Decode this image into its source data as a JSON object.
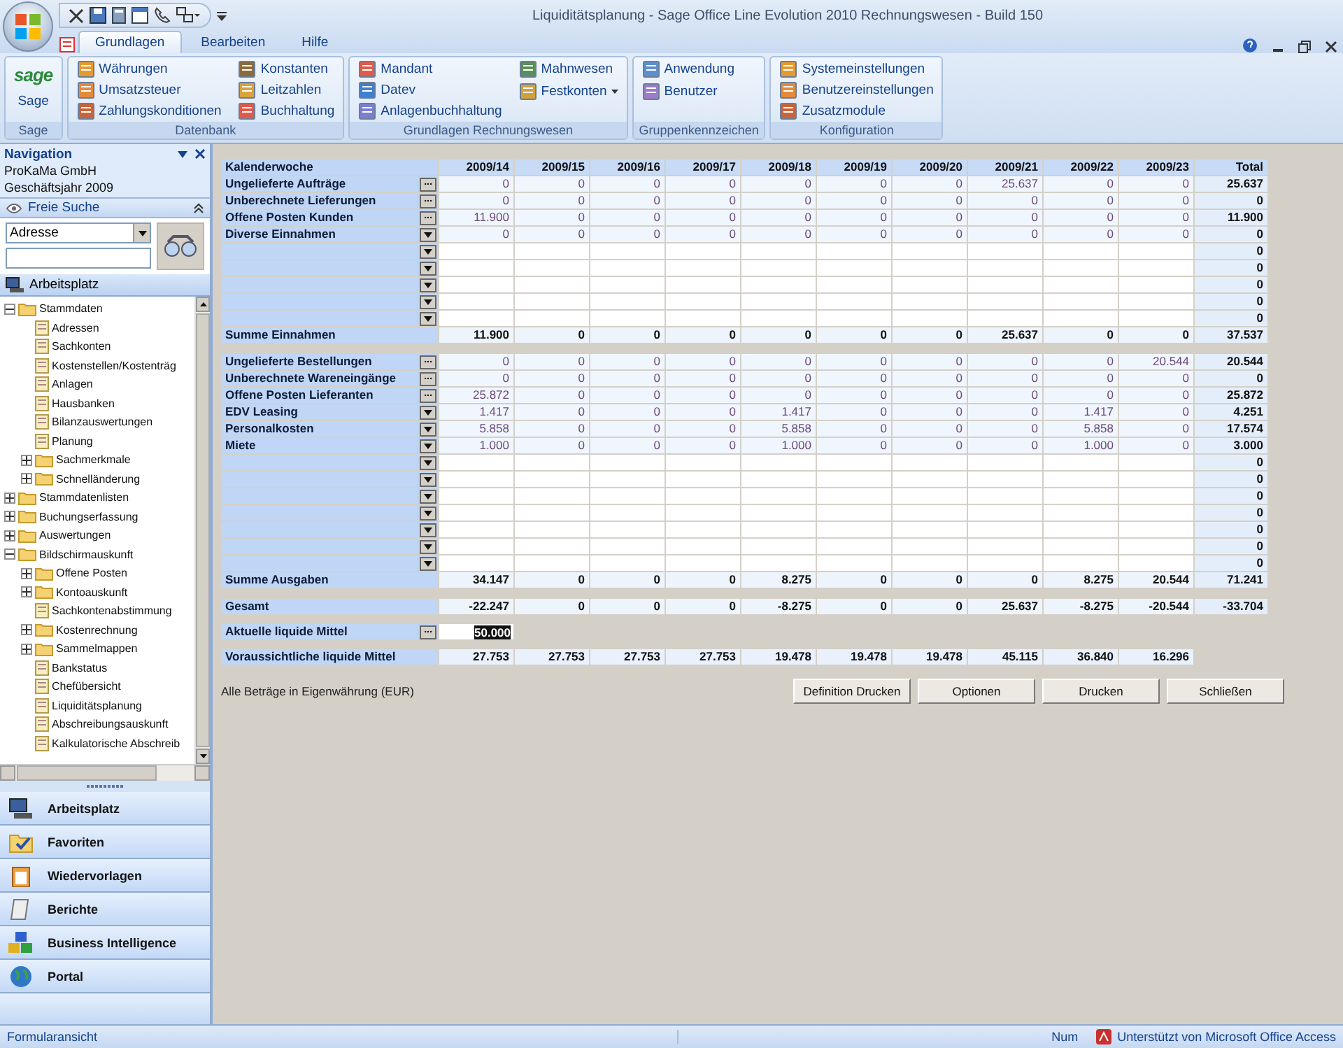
{
  "window": {
    "title": "Liquiditätsplanung - Sage Office Line Evolution 2010 Rechnungswesen - Build 150"
  },
  "ribbon": {
    "tabs": [
      {
        "label": "Grundlagen",
        "selected": true
      },
      {
        "label": "Bearbeiten",
        "selected": false
      },
      {
        "label": "Hilfe",
        "selected": false
      }
    ],
    "groups": [
      {
        "kind": "logo",
        "logo": "sage",
        "caption": "Sage",
        "label": "Sage"
      },
      {
        "kind": "items",
        "label": "Datenbank",
        "columns": [
          [
            {
              "label": "Währungen",
              "dropdown": false
            },
            {
              "label": "Umsatzsteuer",
              "dropdown": false
            },
            {
              "label": "Zahlungskonditionen",
              "dropdown": false
            }
          ],
          [
            {
              "label": "Konstanten",
              "dropdown": false
            },
            {
              "label": "Leitzahlen",
              "dropdown": false
            },
            {
              "label": "Buchhaltung",
              "dropdown": false
            }
          ]
        ]
      },
      {
        "kind": "items",
        "label": "Grundlagen Rechnungswesen",
        "columns": [
          [
            {
              "label": "Mandant",
              "dropdown": false
            },
            {
              "label": "Datev",
              "dropdown": false
            },
            {
              "label": "Anlagenbuchhaltung",
              "dropdown": false
            }
          ],
          [
            {
              "label": "Mahnwesen",
              "dropdown": false
            },
            {
              "label": "Festkonten",
              "dropdown": true
            }
          ]
        ]
      },
      {
        "kind": "items",
        "label": "Gruppenkennzeichen",
        "columns": [
          [
            {
              "label": "Anwendung",
              "dropdown": false
            },
            {
              "label": "Benutzer",
              "dropdown": false
            }
          ]
        ]
      },
      {
        "kind": "items",
        "label": "Konfiguration",
        "columns": [
          [
            {
              "label": "Systemeinstellungen",
              "dropdown": false
            },
            {
              "label": "Benutzereinstellungen",
              "dropdown": false
            },
            {
              "label": "Zusatzmodule",
              "dropdown": false
            }
          ]
        ]
      }
    ]
  },
  "nav": {
    "title": "Navigation",
    "company": "ProKaMa GmbH",
    "fiscal_year": "Geschäftsjahr 2009",
    "search_title": "Freie Suche",
    "search_select": "Adresse",
    "section": "Arbeitsplatz",
    "tree": [
      {
        "kind": "folder",
        "label": "Stammdaten",
        "expanded": true,
        "children": [
          {
            "kind": "doc",
            "label": "Adressen"
          },
          {
            "kind": "doc",
            "label": "Sachkonten"
          },
          {
            "kind": "doc",
            "label": "Kostenstellen/Kostenträg"
          },
          {
            "kind": "doc",
            "label": "Anlagen"
          },
          {
            "kind": "doc",
            "label": "Hausbanken"
          },
          {
            "kind": "doc",
            "label": "Bilanzauswertungen"
          },
          {
            "kind": "doc",
            "label": "Planung"
          },
          {
            "kind": "folder",
            "label": "Sachmerkmale",
            "expanded": false
          },
          {
            "kind": "folder",
            "label": "Schnelländerung",
            "expanded": false
          }
        ]
      },
      {
        "kind": "folder",
        "label": "Stammdatenlisten",
        "expanded": false
      },
      {
        "kind": "folder",
        "label": "Buchungserfassung",
        "expanded": false
      },
      {
        "kind": "folder",
        "label": "Auswertungen",
        "expanded": false
      },
      {
        "kind": "folder",
        "label": "Bildschirmauskunft",
        "expanded": true,
        "children": [
          {
            "kind": "folder",
            "label": "Offene Posten",
            "expanded": false
          },
          {
            "kind": "folder",
            "label": "Kontoauskunft",
            "expanded": false
          },
          {
            "kind": "doc",
            "label": "Sachkontenabstimmung"
          },
          {
            "kind": "folder",
            "label": "Kostenrechnung",
            "expanded": false
          },
          {
            "kind": "folder",
            "label": "Sammelmappen",
            "expanded": false
          },
          {
            "kind": "doc",
            "label": "Bankstatus"
          },
          {
            "kind": "doc",
            "label": "Chefübersicht"
          },
          {
            "kind": "doc",
            "label": "Liquiditätsplanung"
          },
          {
            "kind": "doc",
            "label": "Abschreibungsauskunft"
          },
          {
            "kind": "doc",
            "label": "Kalkulatorische Abschreib"
          }
        ]
      }
    ],
    "buttons": [
      "Arbeitsplatz",
      "Favoriten",
      "Wiedervorlagen",
      "Berichte",
      "Business Intelligence",
      "Portal"
    ]
  },
  "table": {
    "header": "Kalenderwoche",
    "weeks": [
      "2009/14",
      "2009/15",
      "2009/16",
      "2009/17",
      "2009/18",
      "2009/19",
      "2009/20",
      "2009/21",
      "2009/22",
      "2009/23"
    ],
    "total_header": "Total",
    "blocks": [
      {
        "rows": [
          {
            "kind": "entry",
            "label": "Ungelieferte Aufträge",
            "button": {
              "kind": "ellipsis",
              "text": "..."
            },
            "values": [
              "0",
              "0",
              "0",
              "0",
              "0",
              "0",
              "0",
              "25.637",
              "0",
              "0"
            ],
            "total": "25.637"
          },
          {
            "kind": "entry",
            "label": "Unberechnete Lieferungen",
            "button": {
              "kind": "ellipsis",
              "text": "..."
            },
            "values": [
              "0",
              "0",
              "0",
              "0",
              "0",
              "0",
              "0",
              "0",
              "0",
              "0"
            ],
            "total": "0"
          },
          {
            "kind": "entry",
            "label": "Offene Posten Kunden",
            "button": {
              "kind": "ellipsis",
              "text": "..."
            },
            "values": [
              "11.900",
              "0",
              "0",
              "0",
              "0",
              "0",
              "0",
              "0",
              "0",
              "0"
            ],
            "total": "11.900"
          },
          {
            "kind": "entry",
            "label": "Diverse Einnahmen",
            "button": {
              "kind": "dropdown"
            },
            "values": [
              "0",
              "0",
              "0",
              "0",
              "0",
              "0",
              "0",
              "0",
              "0",
              "0"
            ],
            "total": "0"
          },
          {
            "kind": "blank",
            "button": {
              "kind": "dropdown"
            },
            "total": "0"
          },
          {
            "kind": "blank",
            "button": {
              "kind": "dropdown"
            },
            "total": "0"
          },
          {
            "kind": "blank",
            "button": {
              "kind": "dropdown"
            },
            "total": "0"
          },
          {
            "kind": "blank",
            "button": {
              "kind": "dropdown"
            },
            "total": "0"
          },
          {
            "kind": "blank",
            "button": {
              "kind": "dropdown"
            },
            "total": "0"
          },
          {
            "kind": "sum",
            "label": "Summe Einnahmen",
            "values": [
              "11.900",
              "0",
              "0",
              "0",
              "0",
              "0",
              "0",
              "25.637",
              "0",
              "0"
            ],
            "total": "37.537"
          }
        ]
      },
      {
        "rows": [
          {
            "kind": "entry",
            "label": "Ungelieferte Bestellungen",
            "button": {
              "kind": "ellipsis",
              "text": "..."
            },
            "values": [
              "0",
              "0",
              "0",
              "0",
              "0",
              "0",
              "0",
              "0",
              "0",
              "20.544"
            ],
            "total": "20.544"
          },
          {
            "kind": "entry",
            "label": "Unberechnete Wareneingänge",
            "button": {
              "kind": "ellipsis",
              "text": "..."
            },
            "values": [
              "0",
              "0",
              "0",
              "0",
              "0",
              "0",
              "0",
              "0",
              "0",
              "0"
            ],
            "total": "0"
          },
          {
            "kind": "entry",
            "label": "Offene Posten Lieferanten",
            "button": {
              "kind": "ellipsis",
              "text": "..."
            },
            "values": [
              "25.872",
              "0",
              "0",
              "0",
              "0",
              "0",
              "0",
              "0",
              "0",
              "0"
            ],
            "total": "25.872"
          },
          {
            "kind": "entry",
            "label": "EDV Leasing",
            "button": {
              "kind": "dropdown"
            },
            "values": [
              "1.417",
              "0",
              "0",
              "0",
              "1.417",
              "0",
              "0",
              "0",
              "1.417",
              "0"
            ],
            "total": "4.251"
          },
          {
            "kind": "entry",
            "label": "Personalkosten",
            "button": {
              "kind": "dropdown"
            },
            "values": [
              "5.858",
              "0",
              "0",
              "0",
              "5.858",
              "0",
              "0",
              "0",
              "5.858",
              "0"
            ],
            "total": "17.574"
          },
          {
            "kind": "entry",
            "label": "Miete",
            "button": {
              "kind": "dropdown"
            },
            "values": [
              "1.000",
              "0",
              "0",
              "0",
              "1.000",
              "0",
              "0",
              "0",
              "1.000",
              "0"
            ],
            "total": "3.000"
          },
          {
            "kind": "blank",
            "button": {
              "kind": "dropdown"
            },
            "total": "0"
          },
          {
            "kind": "blank",
            "button": {
              "kind": "dropdown"
            },
            "total": "0"
          },
          {
            "kind": "blank",
            "button": {
              "kind": "dropdown"
            },
            "total": "0"
          },
          {
            "kind": "blank",
            "button": {
              "kind": "dropdown"
            },
            "total": "0"
          },
          {
            "kind": "blank",
            "button": {
              "kind": "dropdown"
            },
            "total": "0"
          },
          {
            "kind": "blank",
            "button": {
              "kind": "dropdown"
            },
            "total": "0"
          },
          {
            "kind": "blank",
            "button": {
              "kind": "dropdown"
            },
            "total": "0"
          },
          {
            "kind": "sum",
            "label": "Summe Ausgaben",
            "values": [
              "34.147",
              "0",
              "0",
              "0",
              "8.275",
              "0",
              "0",
              "0",
              "8.275",
              "20.544"
            ],
            "total": "71.241"
          }
        ]
      },
      {
        "rows": [
          {
            "kind": "sum",
            "label": "Gesamt",
            "values": [
              "-22.247",
              "0",
              "0",
              "0",
              "-8.275",
              "0",
              "0",
              "25.637",
              "-8.275",
              "-20.544"
            ],
            "total": "-33.704"
          }
        ]
      },
      {
        "rows": [
          {
            "kind": "input",
            "label": "Aktuelle liquide Mittel",
            "button": {
              "kind": "ellipsis",
              "text": "..."
            },
            "value": "50.000",
            "highlighted": true
          }
        ]
      },
      {
        "rows": [
          {
            "kind": "forecast",
            "label": "Voraussichtliche liquide Mittel",
            "values": [
              "27.753",
              "27.753",
              "27.753",
              "27.753",
              "19.478",
              "19.478",
              "19.478",
              "45.115",
              "36.840",
              "16.296"
            ]
          }
        ]
      }
    ]
  },
  "note": "Alle Beträge in Eigenwährung (EUR)",
  "actions": [
    "Definition Drucken",
    "Optionen",
    "Drucken",
    "Schließen"
  ],
  "status_bar": {
    "left": "Formularansicht",
    "mode": "Num",
    "right": "Unterstützt von Microsoft Office Access"
  }
}
